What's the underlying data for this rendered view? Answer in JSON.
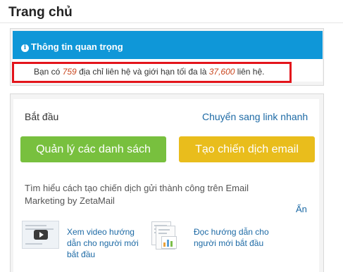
{
  "page": {
    "title": "Trang chủ"
  },
  "info": {
    "heading": "Thông tin quan trọng",
    "icon": "info-icon",
    "text_before": "Bạn có ",
    "contact_count": "759",
    "text_middle": " địa chỉ liên hệ và giới hạn tối đa là ",
    "contact_limit": "37,600",
    "text_after": " liên hệ."
  },
  "start": {
    "title": "Bắt đầu",
    "quick_link": "Chuyển sang link nhanh",
    "btn_lists": "Quản lý các danh sách",
    "btn_campaign": "Tạo chiến dịch email",
    "description": "Tìm hiểu cách tạo chiến dịch gửi thành công trên Email Marketing by ZetaMail",
    "hide": "Ẩn",
    "video_link": "Xem video hướng dẫn cho người mới bắt đầu",
    "doc_link": "Đọc hướng dẫn cho người mới bắt đầu"
  },
  "colors": {
    "header_blue": "#0f97d8",
    "highlight_red": "#e3141b",
    "button_green": "#78c03e",
    "button_yellow": "#e9bd1c",
    "link_blue": "#1d6aa5"
  }
}
